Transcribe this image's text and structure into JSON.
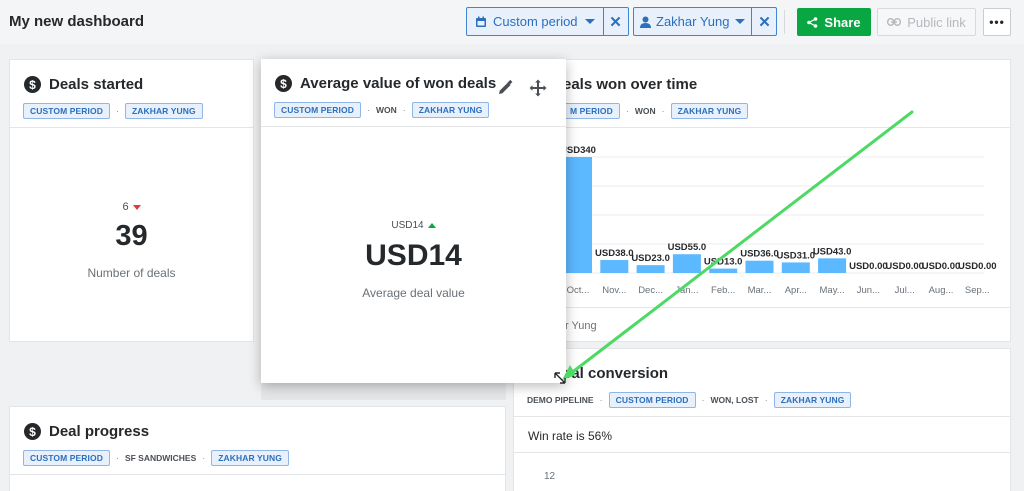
{
  "header": {
    "title": "My new dashboard",
    "period_filter": "Custom period",
    "user_filter": "Zakhar Yung",
    "share_label": "Share",
    "public_link_label": "Public link",
    "more_label": "•••"
  },
  "colors": {
    "accent": "#3f85d4",
    "share_green": "#08a742",
    "bar": "#5cb8ff",
    "arrow": "#4cd964"
  },
  "cards": {
    "deals_started": {
      "title": "Deals started",
      "tags": [
        "CUSTOM PERIOD",
        "ZAKHAR YUNG"
      ],
      "previous": "6",
      "value": "39",
      "caption": "Number of deals"
    },
    "avg_won": {
      "title": "Average value of won deals",
      "tag1": "CUSTOM PERIOD",
      "plain": "WON",
      "tag2": "ZAKHAR YUNG",
      "previous": "USD14",
      "value": "USD14",
      "caption": "Average deal value"
    },
    "deals_won_time": {
      "title": "eals won over time",
      "tag1": "M PERIOD",
      "plain": "WON",
      "tag2": "ZAKHAR YUNG",
      "legend": "r Yung"
    },
    "deal_conversion": {
      "title": "eal conversion",
      "plain1": "DEMO PIPELINE",
      "tag1": "CUSTOM PERIOD",
      "plain2": "WON, LOST",
      "tag2": "ZAKHAR YUNG",
      "win_rate": "Win rate is 56%",
      "y_tick": "12"
    },
    "deal_progress": {
      "title": "Deal progress",
      "tag1": "CUSTOM PERIOD",
      "plain": "SF SANDWICHES",
      "tag2": "ZAKHAR YUNG"
    }
  },
  "chart_data": {
    "type": "bar",
    "categories": [
      "Oct...",
      "Nov...",
      "Dec...",
      "Jan...",
      "Feb...",
      "Mar...",
      "Apr...",
      "May...",
      "Jun...",
      "Jul...",
      "Aug...",
      "Sep..."
    ],
    "values": [
      340,
      38,
      23,
      55,
      13,
      36,
      31,
      43,
      0,
      0,
      0,
      0
    ],
    "labels": [
      "USD340",
      "USD38.0",
      "USD23.0",
      "USD55.0",
      "USD13.0",
      "USD36.0",
      "USD31.0",
      "USD43.0",
      "USD0.00",
      "USD0.00",
      "USD0.00",
      "USD0.00"
    ],
    "ylim": [
      0,
      340
    ],
    "grid": true
  }
}
